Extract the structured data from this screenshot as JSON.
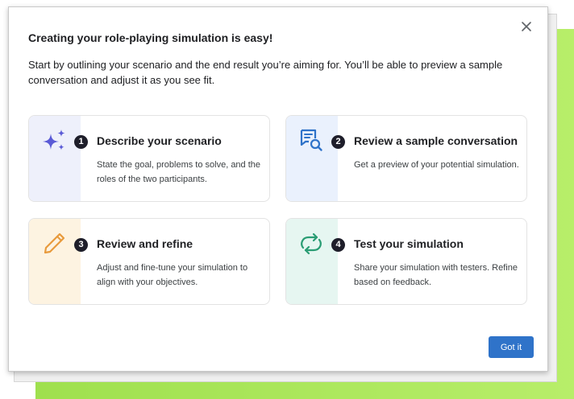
{
  "dialog": {
    "title": "Creating your role-playing simulation is easy!",
    "description": "Start by outlining your scenario and the end result you’re aiming for. You’ll be able to preview a sample conversation and adjust it as you see fit.",
    "close_icon": "close-icon",
    "got_it_label": "Got it"
  },
  "steps": [
    {
      "number": "1",
      "title": "Describe your scenario",
      "description": "State the goal, problems to solve, and the roles of the two participants.",
      "icon": "sparkles-icon",
      "band_color": "#eef0fb",
      "icon_color": "#5b5bd6"
    },
    {
      "number": "2",
      "title": "Review a sample conversation",
      "description": "Get a preview of your potential simulation.",
      "icon": "document-search-icon",
      "band_color": "#eaf1fd",
      "icon_color": "#2f73c9"
    },
    {
      "number": "3",
      "title": "Review and refine",
      "description": "Adjust and fine-tune your simulation to align with your objectives.",
      "icon": "pencil-icon",
      "band_color": "#fdf3e1",
      "icon_color": "#e89a3c"
    },
    {
      "number": "4",
      "title": "Test your simulation",
      "description": "Share your simulation with testers. Refine based on feedback.",
      "icon": "refresh-cycle-icon",
      "band_color": "#e6f6f1",
      "icon_color": "#2a9d74"
    }
  ]
}
